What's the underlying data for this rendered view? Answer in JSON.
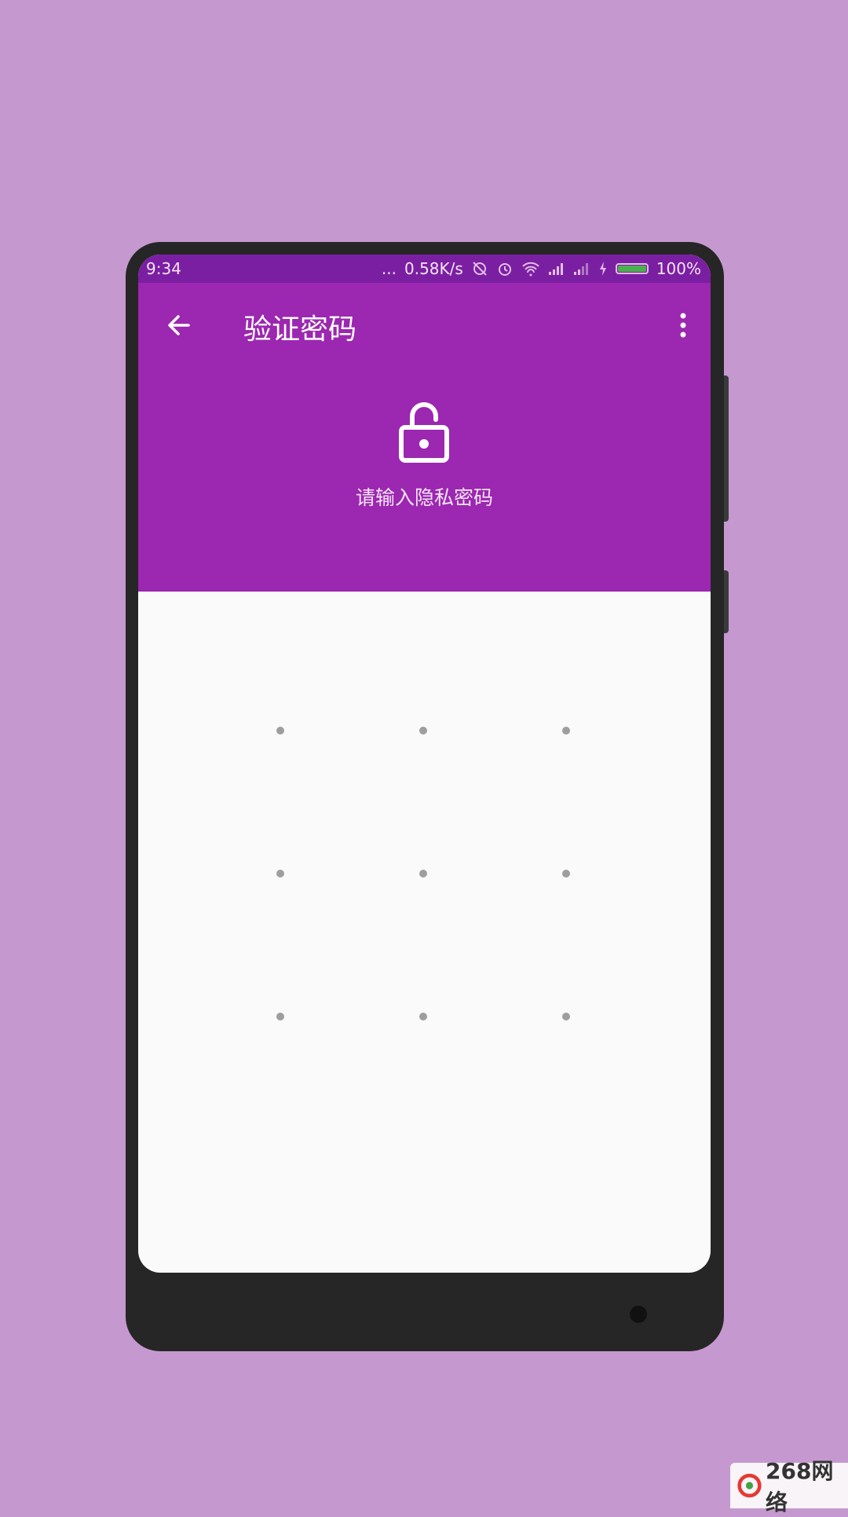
{
  "status_bar": {
    "time": "9:34",
    "dots": "...",
    "network_speed": "0.58K/s",
    "battery_level": 1.0,
    "battery_text": "100%",
    "icons": [
      "sync-off-icon",
      "alarm-icon",
      "wifi-icon",
      "signal-icon",
      "signal-icon-2",
      "charging-icon",
      "battery-icon"
    ]
  },
  "toolbar": {
    "title": "验证密码",
    "back_icon": "arrow-back-icon",
    "menu_icon": "more-vert-icon"
  },
  "header": {
    "icon": "lock-open-icon",
    "prompt": "请输入隐私密码"
  },
  "pattern": {
    "rows": 3,
    "cols": 3
  },
  "watermark": {
    "text": "268网络"
  },
  "colors": {
    "background": "#c599cf",
    "status_bar": "#7b1fa2",
    "primary": "#9c27b0",
    "screen_bg": "#fafafa",
    "dot": "#9e9e9e",
    "phone_body": "#262626"
  }
}
